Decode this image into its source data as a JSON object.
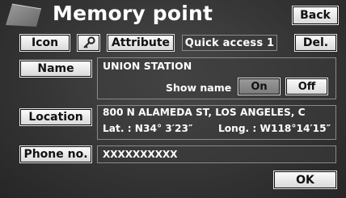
{
  "header": {
    "title": "Memory point",
    "back_label": "Back"
  },
  "toolbar": {
    "icon_label": "Icon",
    "attribute_label": "Attribute",
    "quick_access_text": "Quick access 1",
    "delete_label": "Del."
  },
  "name_row": {
    "button_label": "Name",
    "value": "UNION STATION",
    "show_name_label": "Show name",
    "on_label": "On",
    "off_label": "Off",
    "show_name_selected": "On"
  },
  "location_row": {
    "button_label": "Location",
    "address": "800 N ALAMEDA ST, LOS ANGELES, C",
    "lat": "Lat. : N34° 3′23″",
    "long": "Long. : W118°14′15″"
  },
  "phone_row": {
    "button_label": "Phone no.",
    "value": "XXXXXXXXXX"
  },
  "footer": {
    "ok_label": "OK"
  },
  "icons": {
    "title_icon": "flag-icon",
    "attribute_icon": "key-icon"
  }
}
